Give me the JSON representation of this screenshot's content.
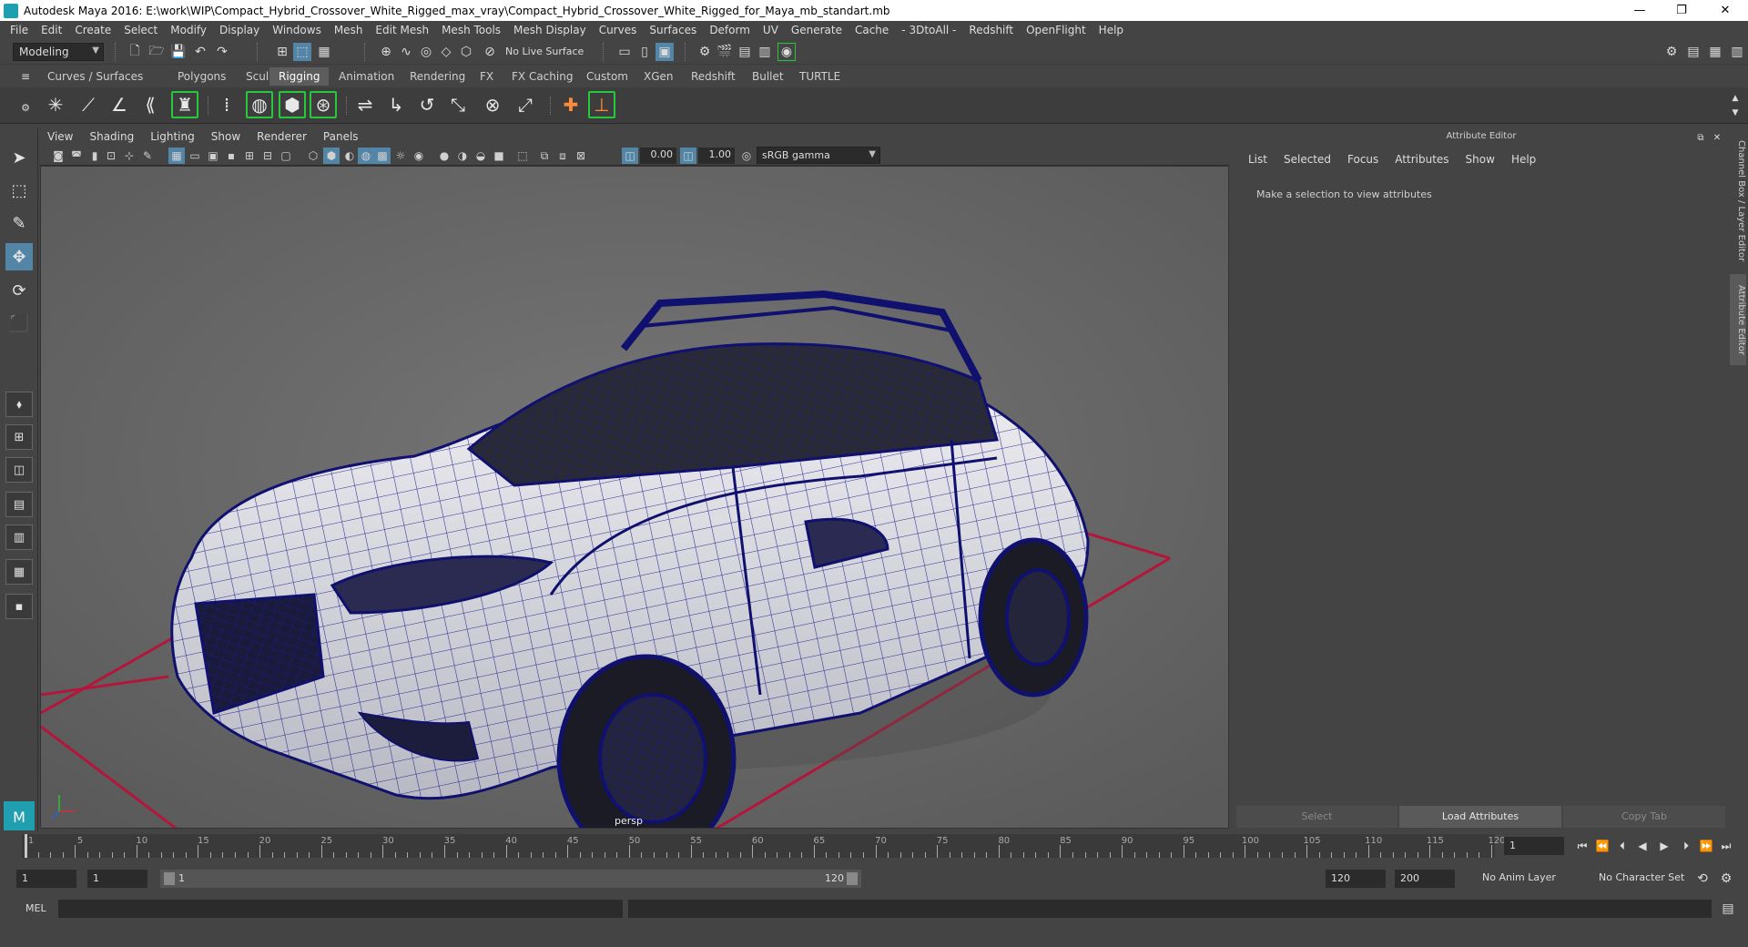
{
  "window": {
    "title": "Autodesk Maya 2016: E:\\work\\WIP\\Compact_Hybrid_Crossover_White_Rigged_max_vray\\Compact_Hybrid_Crossover_White_Rigged_for_Maya_mb_standart.mb",
    "minimize": "—",
    "maximize": "❐",
    "close": "✕"
  },
  "menubar": [
    "File",
    "Edit",
    "Create",
    "Select",
    "Modify",
    "Display",
    "Windows",
    "Mesh",
    "Edit Mesh",
    "Mesh Tools",
    "Mesh Display",
    "Curves",
    "Surfaces",
    "Deform",
    "UV",
    "Generate",
    "Cache",
    "- 3DtoAll -",
    "Redshift",
    "OpenFlight",
    "Help"
  ],
  "statusline": {
    "mode": "Modeling",
    "live_surface": "No Live Surface"
  },
  "shelf_tabs": [
    "Curves / Surfaces",
    "Polygons",
    "Sculpting",
    "Rigging",
    "Animation",
    "Rendering",
    "FX",
    "FX Caching",
    "Custom",
    "XGen",
    "Redshift",
    "Bullet",
    "TURTLE"
  ],
  "active_shelf_tab": "Rigging",
  "viewport": {
    "menu": [
      "View",
      "Shading",
      "Lighting",
      "Show",
      "Renderer",
      "Panels"
    ],
    "exposure": "0.00",
    "gamma": "1.00",
    "color_space": "sRGB gamma",
    "camera_label": "persp"
  },
  "attribute_editor": {
    "header": "Attribute Editor",
    "menu": [
      "List",
      "Selected",
      "Focus",
      "Attributes",
      "Show",
      "Help"
    ],
    "message": "Make a selection to view attributes",
    "buttons": {
      "select": "Select",
      "load": "Load Attributes",
      "copy": "Copy Tab"
    }
  },
  "side_tabs": {
    "channel_box": "Channel Box / Layer Editor",
    "attribute_editor": "Attribute Editor"
  },
  "timeline": {
    "ticks": [
      "1",
      "5",
      "10",
      "15",
      "20",
      "25",
      "30",
      "35",
      "40",
      "45",
      "50",
      "55",
      "60",
      "65",
      "70",
      "75",
      "80",
      "85",
      "90",
      "95",
      "100",
      "105",
      "110",
      "115",
      "120"
    ],
    "current_frame": "1"
  },
  "range": {
    "start": "1",
    "playback_start": "1",
    "slider_left": "1",
    "slider_right": "120",
    "playback_end": "120",
    "end": "200",
    "anim_layer": "No Anim Layer",
    "character_set": "No Character Set"
  },
  "command_line": {
    "language": "MEL"
  },
  "colors": {
    "accent": "#5285a6",
    "wire": "#1a1a8c",
    "grid_red": "#b3163a",
    "shelf_green": "#25c93a"
  }
}
